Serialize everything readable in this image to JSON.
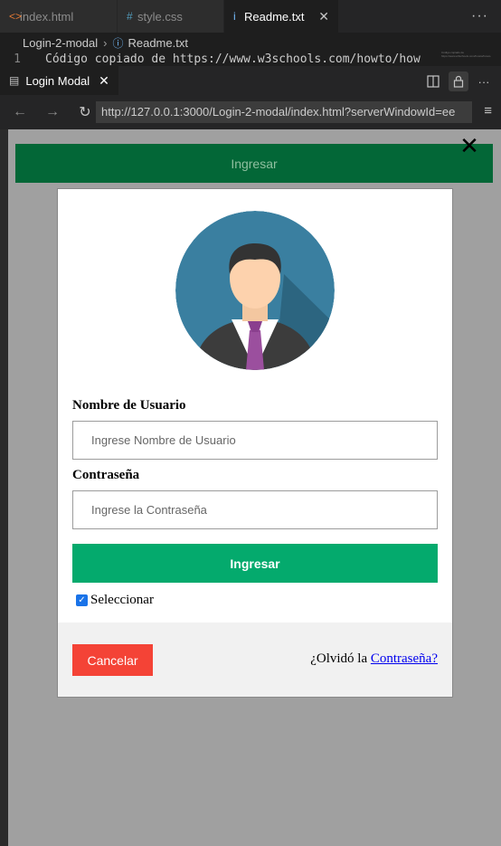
{
  "editor": {
    "tabs": [
      {
        "label": "index.html",
        "icon": "<>"
      },
      {
        "label": "style.css",
        "icon": "#"
      },
      {
        "label": "Readme.txt",
        "icon": "i"
      }
    ],
    "more": "···",
    "breadcrumb": {
      "folder": "Login-2-modal",
      "file": "Readme.txt"
    },
    "code_line_number": "1",
    "code_line_text": "Código copiado de https://www.w3schools.com/howto/how",
    "minimap_text": "Código copiado de https://www.w3schools.com/howto/howto"
  },
  "preview": {
    "tab_label": "Login Modal",
    "url": "http://127.0.0.1:3000/Login-2-modal/index.html?serverWindowId=ee",
    "menu_icon": "≡"
  },
  "page": {
    "open_button_label": "Ingresar",
    "close_symbol": "✕",
    "username_label": "Nombre de Usuario",
    "username_placeholder": "Ingrese Nombre de Usuario",
    "password_label": "Contraseña",
    "password_placeholder": "Ingrese la Contraseña",
    "login_button_label": "Ingresar",
    "remember_label": "Seleccionar",
    "remember_checked": true,
    "cancel_button_label": "Cancelar",
    "forgot_prefix": "¿Olvidó la",
    "forgot_link": "Contraseña?"
  },
  "colors": {
    "open_button_bg": "#036737",
    "login_button_bg": "#04aa6d",
    "cancel_button_bg": "#f44336",
    "backdrop": "#a0a0a0"
  }
}
